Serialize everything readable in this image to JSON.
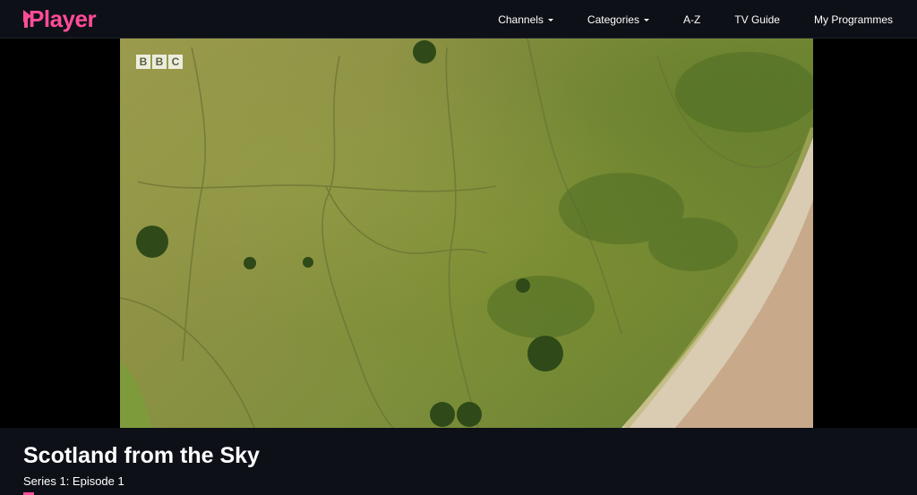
{
  "brand": {
    "logo_text": "Player",
    "color": "#ff4c98"
  },
  "nav": {
    "items": [
      {
        "label": "Channels",
        "dropdown": true
      },
      {
        "label": "Categories",
        "dropdown": true
      },
      {
        "label": "A-Z",
        "dropdown": false
      },
      {
        "label": "TV Guide",
        "dropdown": false
      },
      {
        "label": "My Programmes",
        "dropdown": false
      }
    ]
  },
  "video": {
    "watermark": [
      "B",
      "B",
      "C"
    ]
  },
  "programme": {
    "title": "Scotland from the Sky",
    "episode": "Series 1: Episode 1"
  },
  "colors": {
    "header_bg": "#0d1017",
    "accent": "#ff4c98"
  }
}
